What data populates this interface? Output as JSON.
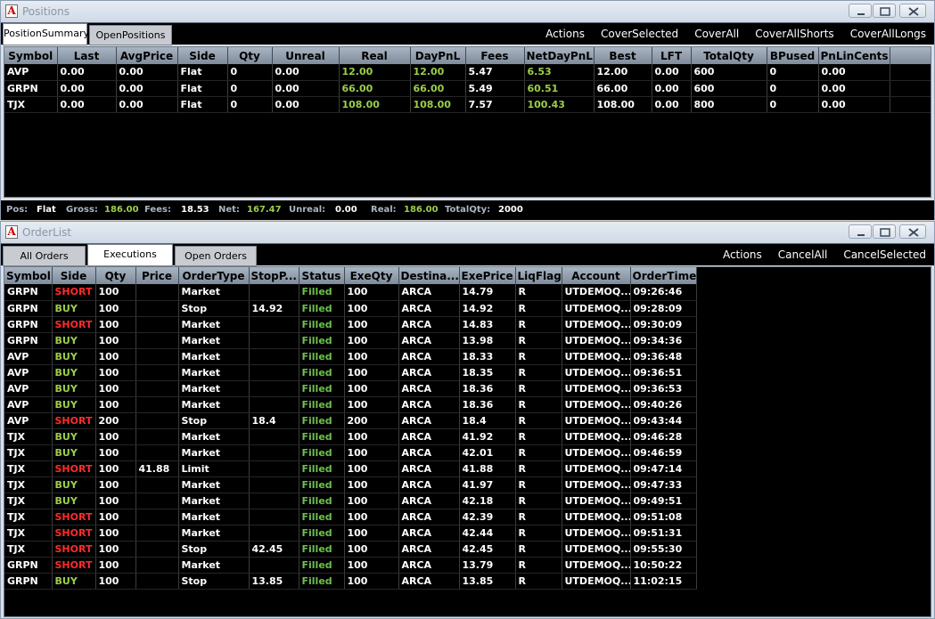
{
  "positions_window": {
    "title": "Positions",
    "tabs": [
      "PositionSummary",
      "OpenPositions"
    ],
    "actions": [
      "Actions",
      "CoverSelected",
      "CoverAll",
      "CoverAllShorts",
      "CoverAllLongs"
    ],
    "columns": [
      "Symbol",
      "Last",
      "AvgPrice",
      "Side",
      "Qty",
      "Unreal",
      "Real",
      "DayPnL",
      "Fees",
      "NetDayPnL",
      "Best",
      "LFT",
      "TotalQty",
      "BPused",
      "PnLinCents"
    ],
    "rows": [
      [
        "AVP",
        "0.00",
        "0.00",
        "Flat",
        "0",
        "0.00",
        "12.00",
        "12.00",
        "5.47",
        "6.53",
        "12.00",
        "0.00",
        "600",
        "0",
        "0.00"
      ],
      [
        "GRPN",
        "0.00",
        "0.00",
        "Flat",
        "0",
        "0.00",
        "66.00",
        "66.00",
        "5.49",
        "60.51",
        "66.00",
        "0.00",
        "600",
        "0",
        "0.00"
      ],
      [
        "TJX",
        "0.00",
        "0.00",
        "Flat",
        "0",
        "0.00",
        "108.00",
        "108.00",
        "7.57",
        "100.43",
        "108.00",
        "0.00",
        "800",
        "0",
        "0.00"
      ]
    ],
    "summary": {
      "pos_label": "Pos:",
      "pos": "Flat",
      "gross_label": "Gross:",
      "gross": "186.00",
      "fees_label": "Fees:",
      "fees": "18.53",
      "net_label": "Net:",
      "net": "167.47",
      "unreal_label": "Unreal:",
      "unreal": "0.00",
      "real_label": "Real:",
      "real": "186.00",
      "totalqty_label": "TotalQty:",
      "totalqty": "2000"
    }
  },
  "orders_window": {
    "title": "OrderList",
    "tabs": [
      "All Orders",
      "Executions",
      "Open Orders"
    ],
    "actions": [
      "Actions",
      "CancelAll",
      "CancelSelected"
    ],
    "columns": [
      "Symbol",
      "Side",
      "Qty",
      "Price",
      "OrderType",
      "StopP...",
      "Status",
      "ExeQty",
      "Destina...",
      "ExePrice",
      "LiqFlag",
      "Account",
      "OrderTime"
    ],
    "rows": [
      [
        "GRPN",
        "SHORT",
        "100",
        "",
        "Market",
        "",
        "Filled",
        "100",
        "ARCA",
        "14.79",
        "R",
        "UTDEMOQ...",
        "09:26:46"
      ],
      [
        "GRPN",
        "BUY",
        "100",
        "",
        "Stop",
        "14.92",
        "Filled",
        "100",
        "ARCA",
        "14.92",
        "R",
        "UTDEMOQ...",
        "09:28:09"
      ],
      [
        "GRPN",
        "SHORT",
        "100",
        "",
        "Market",
        "",
        "Filled",
        "100",
        "ARCA",
        "14.83",
        "R",
        "UTDEMOQ...",
        "09:30:09"
      ],
      [
        "GRPN",
        "BUY",
        "100",
        "",
        "Market",
        "",
        "Filled",
        "100",
        "ARCA",
        "13.98",
        "R",
        "UTDEMOQ...",
        "09:34:36"
      ],
      [
        "AVP",
        "BUY",
        "100",
        "",
        "Market",
        "",
        "Filled",
        "100",
        "ARCA",
        "18.33",
        "R",
        "UTDEMOQ...",
        "09:36:48"
      ],
      [
        "AVP",
        "BUY",
        "100",
        "",
        "Market",
        "",
        "Filled",
        "100",
        "ARCA",
        "18.35",
        "R",
        "UTDEMOQ...",
        "09:36:51"
      ],
      [
        "AVP",
        "BUY",
        "100",
        "",
        "Market",
        "",
        "Filled",
        "100",
        "ARCA",
        "18.36",
        "R",
        "UTDEMOQ...",
        "09:36:53"
      ],
      [
        "AVP",
        "BUY",
        "100",
        "",
        "Market",
        "",
        "Filled",
        "100",
        "ARCA",
        "18.36",
        "R",
        "UTDEMOQ...",
        "09:40:26"
      ],
      [
        "AVP",
        "SHORT",
        "200",
        "",
        "Stop",
        "18.4",
        "Filled",
        "200",
        "ARCA",
        "18.4",
        "R",
        "UTDEMOQ...",
        "09:43:44"
      ],
      [
        "TJX",
        "BUY",
        "100",
        "",
        "Market",
        "",
        "Filled",
        "100",
        "ARCA",
        "41.92",
        "R",
        "UTDEMOQ...",
        "09:46:28"
      ],
      [
        "TJX",
        "BUY",
        "100",
        "",
        "Market",
        "",
        "Filled",
        "100",
        "ARCA",
        "42.01",
        "R",
        "UTDEMOQ...",
        "09:46:59"
      ],
      [
        "TJX",
        "SHORT",
        "100",
        "41.88",
        "Limit",
        "",
        "Filled",
        "100",
        "ARCA",
        "41.88",
        "R",
        "UTDEMOQ...",
        "09:47:14"
      ],
      [
        "TJX",
        "BUY",
        "100",
        "",
        "Market",
        "",
        "Filled",
        "100",
        "ARCA",
        "41.97",
        "R",
        "UTDEMOQ...",
        "09:47:33"
      ],
      [
        "TJX",
        "BUY",
        "100",
        "",
        "Market",
        "",
        "Filled",
        "100",
        "ARCA",
        "42.18",
        "R",
        "UTDEMOQ...",
        "09:49:51"
      ],
      [
        "TJX",
        "SHORT",
        "100",
        "",
        "Market",
        "",
        "Filled",
        "100",
        "ARCA",
        "42.39",
        "R",
        "UTDEMOQ...",
        "09:51:08"
      ],
      [
        "TJX",
        "SHORT",
        "100",
        "",
        "Market",
        "",
        "Filled",
        "100",
        "ARCA",
        "42.44",
        "R",
        "UTDEMOQ...",
        "09:51:31"
      ],
      [
        "TJX",
        "SHORT",
        "100",
        "",
        "Stop",
        "42.45",
        "Filled",
        "100",
        "ARCA",
        "42.45",
        "R",
        "UTDEMOQ...",
        "09:55:30"
      ],
      [
        "GRPN",
        "SHORT",
        "100",
        "",
        "Market",
        "",
        "Filled",
        "100",
        "ARCA",
        "13.79",
        "R",
        "UTDEMOQ...",
        "10:50:22"
      ],
      [
        "GRPN",
        "BUY",
        "100",
        "",
        "Stop",
        "13.85",
        "Filled",
        "100",
        "ARCA",
        "13.85",
        "R",
        "UTDEMOQ...",
        "11:02:15"
      ]
    ]
  },
  "colors": {
    "positive": "#9bce4a",
    "short": "#ff2b2b",
    "buy": "#9bce4a",
    "filled": "#6cc04a"
  }
}
